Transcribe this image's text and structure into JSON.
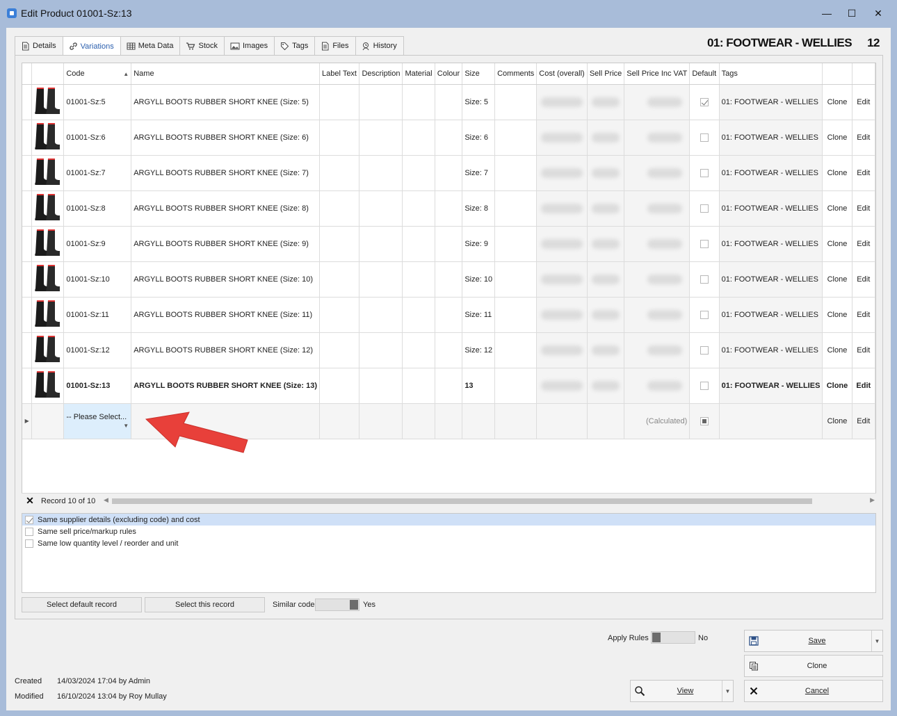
{
  "window": {
    "title": "Edit Product 01001-Sz:13",
    "minimize": "—",
    "maximize": "☐",
    "close": "✕"
  },
  "header": {
    "category": "01: FOOTWEAR - WELLIES",
    "size": "12"
  },
  "tabs": [
    {
      "label": "Details",
      "icon": "document-icon"
    },
    {
      "label": "Variations",
      "icon": "link-icon",
      "active": true
    },
    {
      "label": "Meta Data",
      "icon": "table-icon"
    },
    {
      "label": "Stock",
      "icon": "cart-icon"
    },
    {
      "label": "Images",
      "icon": "image-icon"
    },
    {
      "label": "Tags",
      "icon": "tag-icon"
    },
    {
      "label": "Files",
      "icon": "files-icon"
    },
    {
      "label": "History",
      "icon": "history-icon"
    }
  ],
  "grid": {
    "columns": [
      "Code",
      "Name",
      "Label Text",
      "Description",
      "Material",
      "Colour",
      "Size",
      "Comments",
      "Cost (overall)",
      "Sell Price",
      "Sell Price Inc VAT",
      "Default",
      "Tags"
    ],
    "rows": [
      {
        "code": "01001-Sz:5",
        "name": "ARGYLL BOOTS RUBBER SHORT KNEE (Size: 5)",
        "size": "Size: 5",
        "default": true,
        "tags": "01: FOOTWEAR - WELLIES",
        "clone": "Clone",
        "edit": "Edit"
      },
      {
        "code": "01001-Sz:6",
        "name": "ARGYLL BOOTS RUBBER SHORT KNEE (Size: 6)",
        "size": "Size: 6",
        "default": false,
        "tags": "01: FOOTWEAR - WELLIES",
        "clone": "Clone",
        "edit": "Edit"
      },
      {
        "code": "01001-Sz:7",
        "name": "ARGYLL BOOTS RUBBER SHORT KNEE (Size: 7)",
        "size": "Size: 7",
        "default": false,
        "tags": "01: FOOTWEAR - WELLIES",
        "clone": "Clone",
        "edit": "Edit"
      },
      {
        "code": "01001-Sz:8",
        "name": "ARGYLL BOOTS RUBBER SHORT KNEE (Size: 8)",
        "size": "Size: 8",
        "default": false,
        "tags": "01: FOOTWEAR - WELLIES",
        "clone": "Clone",
        "edit": "Edit"
      },
      {
        "code": "01001-Sz:9",
        "name": "ARGYLL BOOTS RUBBER SHORT KNEE (Size: 9)",
        "size": "Size: 9",
        "default": false,
        "tags": "01: FOOTWEAR - WELLIES",
        "clone": "Clone",
        "edit": "Edit"
      },
      {
        "code": "01001-Sz:10",
        "name": "ARGYLL BOOTS RUBBER SHORT KNEE (Size: 10)",
        "size": "Size: 10",
        "default": false,
        "tags": "01: FOOTWEAR - WELLIES",
        "clone": "Clone",
        "edit": "Edit"
      },
      {
        "code": "01001-Sz:11",
        "name": "ARGYLL BOOTS RUBBER SHORT KNEE (Size: 11)",
        "size": "Size: 11",
        "default": false,
        "tags": "01: FOOTWEAR - WELLIES",
        "clone": "Clone",
        "edit": "Edit"
      },
      {
        "code": "01001-Sz:12",
        "name": "ARGYLL BOOTS RUBBER SHORT KNEE (Size: 12)",
        "size": "Size: 12",
        "default": false,
        "tags": "01: FOOTWEAR - WELLIES",
        "clone": "Clone",
        "edit": "Edit"
      },
      {
        "code": "01001-Sz:13",
        "name": "ARGYLL BOOTS RUBBER SHORT KNEE (Size: 13)",
        "size": "13",
        "default": false,
        "tags": "01: FOOTWEAR - WELLIES",
        "clone": "Clone",
        "edit": "Edit",
        "current": true
      }
    ],
    "new_row": {
      "select_placeholder": "-- Please Select...",
      "calculated": "(Calculated)",
      "clone": "Clone",
      "edit": "Edit"
    }
  },
  "navigator": {
    "close": "✕",
    "record_text": "Record 10 of 10"
  },
  "options": [
    {
      "label": "Same supplier details (excluding code) and cost",
      "checked": true
    },
    {
      "label": "Same sell price/markup rules",
      "checked": false
    },
    {
      "label": "Same low quantity level / reorder and unit",
      "checked": false
    }
  ],
  "panel_buttons": {
    "select_default": "Select default record",
    "select_this": "Select this record",
    "similar_code_label": "Similar code",
    "similar_code_value": "Yes"
  },
  "apply_rules": {
    "label": "Apply Rules",
    "value": "No"
  },
  "footer": {
    "created_label": "Created",
    "created_value": "14/03/2024 17:04 by Admin",
    "modified_label": "Modified",
    "modified_value": "16/10/2024 13:04 by Roy Mullay",
    "view": "View",
    "save": "Save",
    "clone": "Clone",
    "cancel": "Cancel"
  },
  "colors": {
    "window_bg": "#a8bcd9",
    "accent": "#2b5fae",
    "arrow": "#e8403a"
  }
}
